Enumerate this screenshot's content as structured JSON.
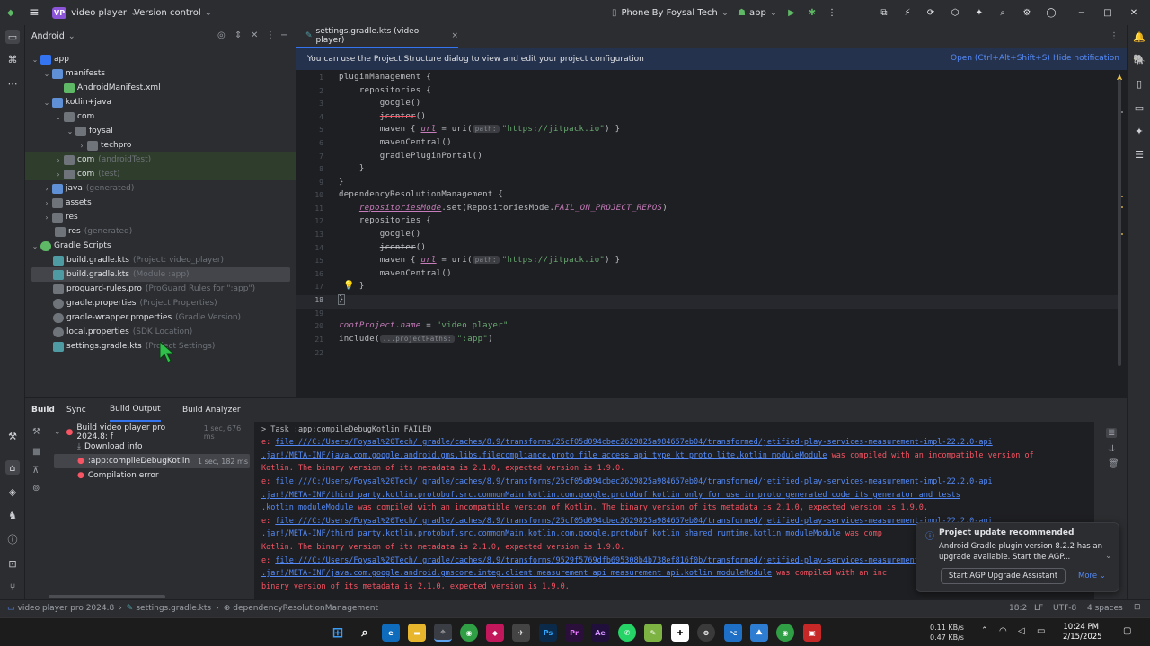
{
  "titlebar": {
    "project_badge": "VP",
    "project_name": "video player",
    "vcs": "Version control",
    "device": "Phone By Foysal Tech",
    "run_config": "app"
  },
  "project_panel": {
    "title": "Android",
    "tree": [
      {
        "label": "app",
        "note": ""
      },
      {
        "label": "manifests",
        "note": ""
      },
      {
        "label": "AndroidManifest.xml",
        "note": ""
      },
      {
        "label": "kotlin+java",
        "note": ""
      },
      {
        "label": "com",
        "note": ""
      },
      {
        "label": "foysal",
        "note": ""
      },
      {
        "label": "techpro",
        "note": ""
      },
      {
        "label": "com",
        "note": "(androidTest)"
      },
      {
        "label": "com",
        "note": "(test)"
      },
      {
        "label": "java",
        "note": "(generated)"
      },
      {
        "label": "assets",
        "note": ""
      },
      {
        "label": "res",
        "note": ""
      },
      {
        "label": "res",
        "note": "(generated)"
      },
      {
        "label": "Gradle Scripts",
        "note": ""
      },
      {
        "label": "build.gradle.kts",
        "note": "(Project: video_player)"
      },
      {
        "label": "build.gradle.kts",
        "note": "(Module :app)"
      },
      {
        "label": "proguard-rules.pro",
        "note": "(ProGuard Rules for \":app\")"
      },
      {
        "label": "gradle.properties",
        "note": "(Project Properties)"
      },
      {
        "label": "gradle-wrapper.properties",
        "note": "(Gradle Version)"
      },
      {
        "label": "local.properties",
        "note": "(SDK Location)"
      },
      {
        "label": "settings.gradle.kts",
        "note": "(Project Settings)"
      }
    ]
  },
  "editor": {
    "tab": "settings.gradle.kts (video player)",
    "banner": {
      "text": "You can use the Project Structure dialog to view and edit your project configuration",
      "open": "Open (Ctrl+Alt+Shift+S)",
      "hide": "Hide notification"
    },
    "line_numbers": [
      "1",
      "2",
      "3",
      "4",
      "5",
      "6",
      "7",
      "8",
      "9",
      "10",
      "11",
      "12",
      "13",
      "14",
      "15",
      "16",
      "17",
      "18",
      "19",
      "20",
      "21",
      "22"
    ],
    "lines": {
      "l1": "pluginManagement {",
      "l2": "    repositories {",
      "l3": "        google()",
      "l4": "jcenter",
      "l4b": "()",
      "l5a": "        maven { ",
      "l5b": "url",
      "l5c": " = uri(",
      "l5h": "path:",
      "l5s": "\"https://jitpack.io\"",
      "l5d": ") }",
      "l6": "        mavenCentral()",
      "l7": "        gradlePluginPortal()",
      "l8": "    }",
      "l9": "}",
      "l10": "dependencyResolutionManagement {",
      "l11a": "repositoriesMode",
      "l11b": ".set(RepositoriesMode.",
      "l11c": "FAIL_ON_PROJECT_REPOS",
      "l11d": ")",
      "l12": "    repositories {",
      "l13": "        google()",
      "l14": "jcenter",
      "l14b": "()",
      "l15a": "        maven { ",
      "l15b": "url",
      "l15c": " = uri(",
      "l15h": "path:",
      "l15s": "\"https://jitpack.io\"",
      "l15d": ") }",
      "l16": "        mavenCentral()",
      "l17": "    }",
      "l18": "}",
      "l20a": "rootProject",
      "l20b": ".",
      "l20c": "name",
      "l20d": " = ",
      "l20s": "\"video player\"",
      "l21a": "include(",
      "l21h": "...projectPaths:",
      "l21s": "\":app\"",
      "l21d": ")"
    }
  },
  "build": {
    "tabs": [
      "Build",
      "Sync",
      "Build Output",
      "Build Analyzer"
    ],
    "tree": [
      {
        "label": "Build video player pro 2024.8: f",
        "time": "1 sec, 676 ms"
      },
      {
        "label": "Download info",
        "time": ""
      },
      {
        "label": ":app:compileDebugKotlin",
        "time": "1 sec, 182 ms"
      },
      {
        "label": "Compilation error",
        "time": ""
      }
    ],
    "console": {
      "c0": "> Task :app:compileDebugKotlin FAILED",
      "c1e": "e: ",
      "c1l": "file:///C:/Users/Foysal%20Tech/.gradle/caches/8.9/transforms/25cf05d094cbec2629825a984657eb04/transformed/jetified-play-services-measurement-impl-22.2.0-api",
      "c2l": ".jar!/META-INF/java.com.google.android.gms.libs.filecompliance.proto_file_access_api_type_kt_proto_lite.kotlin_moduleModule",
      "c2t": " was compiled with an incompatible version of",
      "c3": "Kotlin. The binary version of its metadata is 2.1.0, expected version is 1.9.0.",
      "c4e": "e: ",
      "c4l": "file:///C:/Users/Foysal%20Tech/.gradle/caches/8.9/transforms/25cf05d094cbec2629825a984657eb04/transformed/jetified-play-services-measurement-impl-22.2.0-api",
      "c5l": ".jar!/META-INF/third_party.kotlin.protobuf.src.commonMain.kotlin.com.google.protobuf.kotlin_only_for_use_in_proto_generated_code_its_generator_and_tests",
      "c6l": ".kotlin_moduleModule",
      "c6t": " was compiled with an incompatible version of Kotlin. The binary version of its metadata is 2.1.0, expected version is 1.9.0.",
      "c7e": "e: ",
      "c7l": "file:///C:/Users/Foysal%20Tech/.gradle/caches/8.9/transforms/25cf05d094cbec2629825a984657eb04/transformed/jetified-play-services-measurement-impl-22.2.0-api",
      "c8l": ".jar!/META-INF/third_party.kotlin.protobuf.src.commonMain.kotlin.com.google.protobuf.kotlin_shared_runtime.kotlin_moduleModule",
      "c8t": " was comp",
      "c9": "Kotlin. The binary version of its metadata is 2.1.0, expected version is 1.9.0.",
      "c10e": "e: ",
      "c10l": "file:///C:/Users/Foysal%20Tech/.gradle/caches/8.9/transforms/9529f5769dfb695308b4b738ef816f0b/transformed/jetified-play-services-measurement-api",
      "c11l": ".jar!/META-INF/java.com.google.android.gmscore.integ.client.measurement_api_measurement_api.kotlin_moduleModule",
      "c11t": " was compiled with an inc",
      "c12": "binary version of its metadata is 2.1.0, expected version is 1.9.0."
    }
  },
  "notification": {
    "title": "Project update recommended",
    "body": "Android Gradle plugin version 8.2.2 has an upgrade available. Start the AGP...",
    "button": "Start AGP Upgrade Assistant",
    "more": "More"
  },
  "statusbar": {
    "crumb1": "video player pro 2024.8",
    "crumb2": "settings.gradle.kts",
    "crumb3": "dependencyResolutionManagement",
    "pos": "18:2",
    "eol": "LF",
    "enc": "UTF-8",
    "indent": "4 spaces"
  },
  "taskbar": {
    "net_up": "0.11 KB/s",
    "net_down": "0.47 KB/s",
    "time": "10:24 PM",
    "date": "2/15/2025"
  },
  "colors": {
    "accent": "#548af7",
    "error": "#f75464",
    "selection": "#2e436e"
  }
}
